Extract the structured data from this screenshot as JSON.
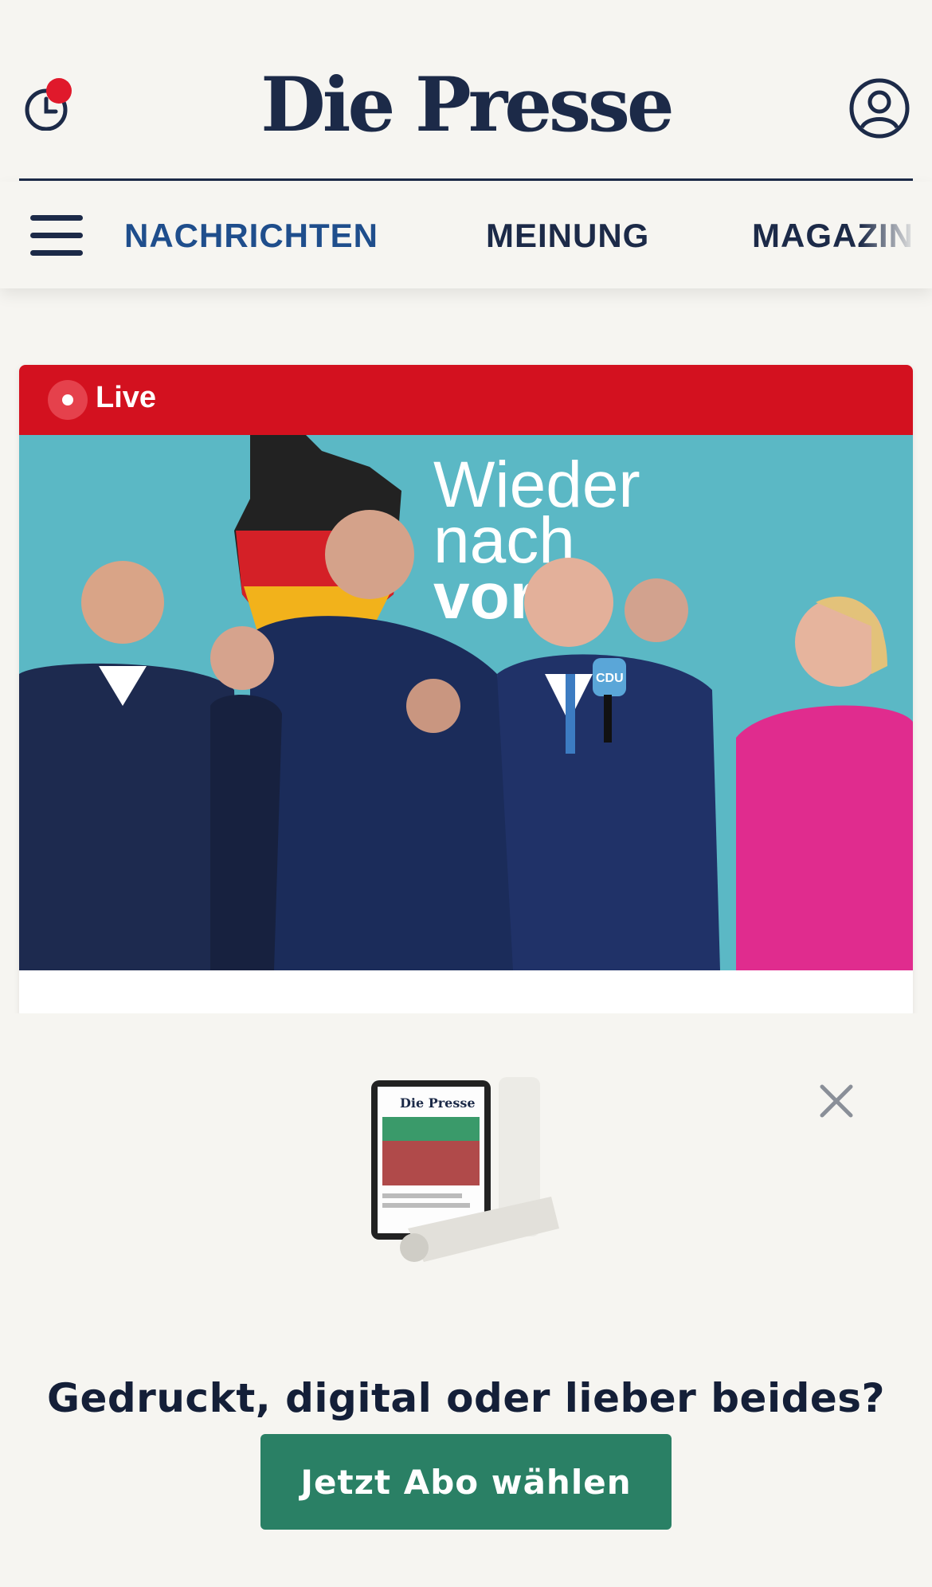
{
  "header": {
    "logo_text": "Die Presse"
  },
  "nav": {
    "items": [
      {
        "label": "NACHRICHTEN"
      },
      {
        "label": "MEINUNG"
      },
      {
        "label": "MAGAZIN"
      }
    ]
  },
  "article": {
    "live_label": "Live",
    "photo_sign_text": [
      "Wieder",
      "nach",
      "vorne"
    ],
    "mic_text": "CDU"
  },
  "subscription_modal": {
    "headline": "Gedruckt, digital oder lieber beides?",
    "cta_label": "Jetzt Abo wählen",
    "promo_logo_text": "Die Presse"
  },
  "colors": {
    "navy": "#1c2a48",
    "live_red": "#d3111f",
    "cta_green": "#2a8065",
    "notification_red": "#e0192b",
    "active_nav_blue": "#1f4e8c"
  }
}
